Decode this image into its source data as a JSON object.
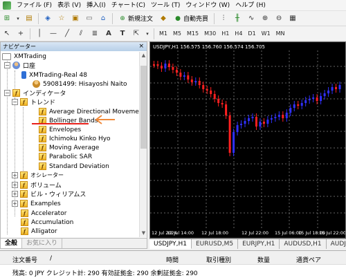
{
  "menu": [
    "ファイル (F)",
    "表示 (V)",
    "挿入(I)",
    "チャート(C)",
    "ツール (T)",
    "ウィンドウ (W)",
    "ヘルプ (H)"
  ],
  "toolbar1": {
    "new_order": "新規注文",
    "auto_trade": "自動売買"
  },
  "timeframes": [
    "M1",
    "M5",
    "M15",
    "M30",
    "H1",
    "H4",
    "D1",
    "W1",
    "MN"
  ],
  "navigator": {
    "title": "ナビゲーター",
    "close": "×",
    "root": "XMTrading",
    "accounts_label": "口座",
    "server": "XMTrading-Real 48",
    "account": "59081499: Hisayoshi Naito",
    "indicators": "インディケータ",
    "trend": "トレンド",
    "trend_items": [
      "Average Directional Movement Index",
      "Bollinger Bands",
      "Envelopes",
      "Ichimoku Kinko Hyo",
      "Moving Average",
      "Parabolic SAR",
      "Standard Deviation"
    ],
    "groups": [
      "オシレーター",
      "ボリューム",
      "ビル・ウィリアムス",
      "Examples"
    ],
    "root_indicators": [
      "Accelerator",
      "Accumulation",
      "Alligator"
    ],
    "tabs": [
      "全般",
      "お気に入り"
    ]
  },
  "chart": {
    "header": "USDJPY,H1  156.575 156.760 156.574 156.705",
    "x_labels": [
      "12 Jul 2024",
      "12 Jul 14:00",
      "12 Jul 18:00",
      "12 Jul 22:00",
      "15 Jul 06:00",
      "15 Jul 18:00",
      "15 Jul 22:00"
    ],
    "tabs": [
      "USDJPY,H1",
      "EURUSD,M5",
      "EURJPY,H1",
      "AUDUSD,H1",
      "AUDJ"
    ],
    "colors": {
      "bull": "#3030ff",
      "bear": "#ff2020",
      "grid": "#666666",
      "bg": "#000000"
    }
  },
  "terminal": {
    "columns": [
      "注文番号",
      "/",
      "時間",
      "取引種別",
      "数量",
      "通貨ペア"
    ],
    "balance_text": "残高: 0 JPY  クレジット計: 290  有効証拠金: 290  余剰証拠金: 290"
  }
}
